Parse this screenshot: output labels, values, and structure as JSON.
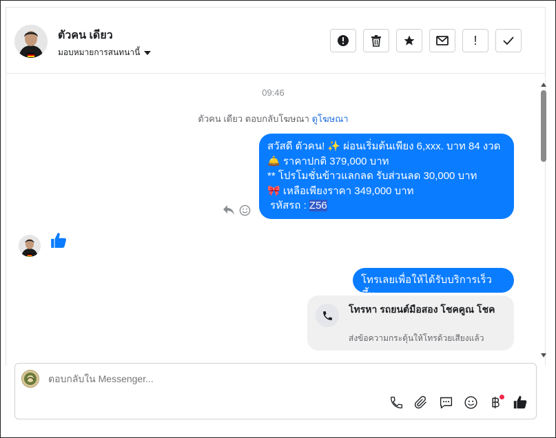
{
  "header": {
    "contact_name": "ตัวคน เดียว",
    "assign_label": "มอบหมายการสนทนานี้",
    "actions": [
      "spam-icon",
      "trash-icon",
      "star-icon",
      "envelope-icon",
      "exclamation-icon",
      "check-icon"
    ],
    "exclamation_text": "!"
  },
  "chat": {
    "timestamp": "09:46",
    "reply_note": "ตัวคน เดียว ตอบกลับโฆษณา",
    "reply_link": "ดูโฆษณา",
    "message1": {
      "line1": "สวัสดี ตัวคน! ✨  ผ่อนเริ่มต้นเพียง 6,xxx. บาท 84 งวด",
      "line2": "🛎️ ราคาปกติ 379,000 บาท",
      "line3": "** โปรโมชั่นข้าวแลกลด รับส่วนลด 30,000 บาท",
      "line4": "🎀  เหลือเพียงราคา 349,000 บาท",
      "line5_prefix": " รหัสรถ : ",
      "line5_code": "Z56"
    },
    "message2": "โทรเลยเพื่อให้ได้รับบริการเร็วขึ้น",
    "call_card": {
      "title": "โทรหา รถยนต์มือสอง โชคคูณ โชค",
      "subtitle": "ส่งข้อความกระตุ้นให้โทรด้วยเสียงแล้ว"
    }
  },
  "composer": {
    "placeholder": "ตอบกลับใน Messenger...",
    "icons": [
      "phone-icon",
      "attachment-icon",
      "chat-icon",
      "emoji-icon",
      "baht-icon",
      "thumbs-up-icon"
    ]
  },
  "colors": {
    "accent": "#0a7cff",
    "link": "#216fdb",
    "notification": "#f02849"
  }
}
